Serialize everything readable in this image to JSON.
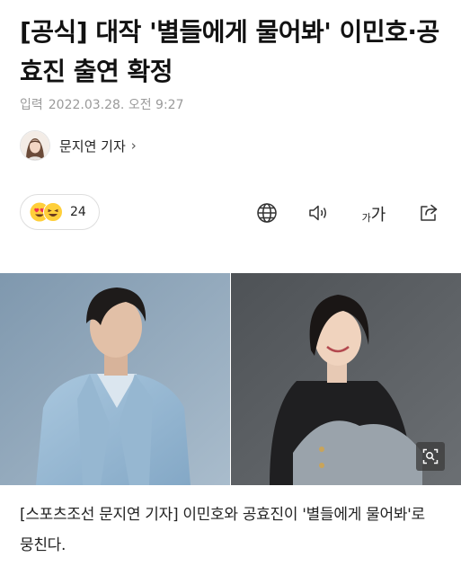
{
  "article": {
    "headline": "[공식] 대작 '별들에게 물어봐' 이민호·공효진 출연 확정",
    "date_label": "입력",
    "date_value": "2022.03.28. 오전 9:27",
    "reporter": {
      "name": "문지연 기자",
      "chevron": "›"
    },
    "reactions": {
      "count": "24",
      "emojis": [
        "heart-eyes-emoji",
        "laughing-emoji"
      ]
    },
    "toolbar": {
      "icons": [
        "globe-icon",
        "speaker-icon",
        "font-size-icon",
        "share-icon"
      ],
      "font_small": "가",
      "font_big": "가"
    },
    "photo": {
      "zoom_icon": "magnifier-icon"
    },
    "caption": "[스포츠조선 문지연 기자] 이민호와 공효진이 '별들에게 물어봐'로 뭉친다."
  },
  "colors": {
    "text": "#121212",
    "meta": "#9a9a9a",
    "border": "#dedede",
    "photo_left_bg": "#8aa3b8",
    "photo_right_bg": "#55585c"
  }
}
